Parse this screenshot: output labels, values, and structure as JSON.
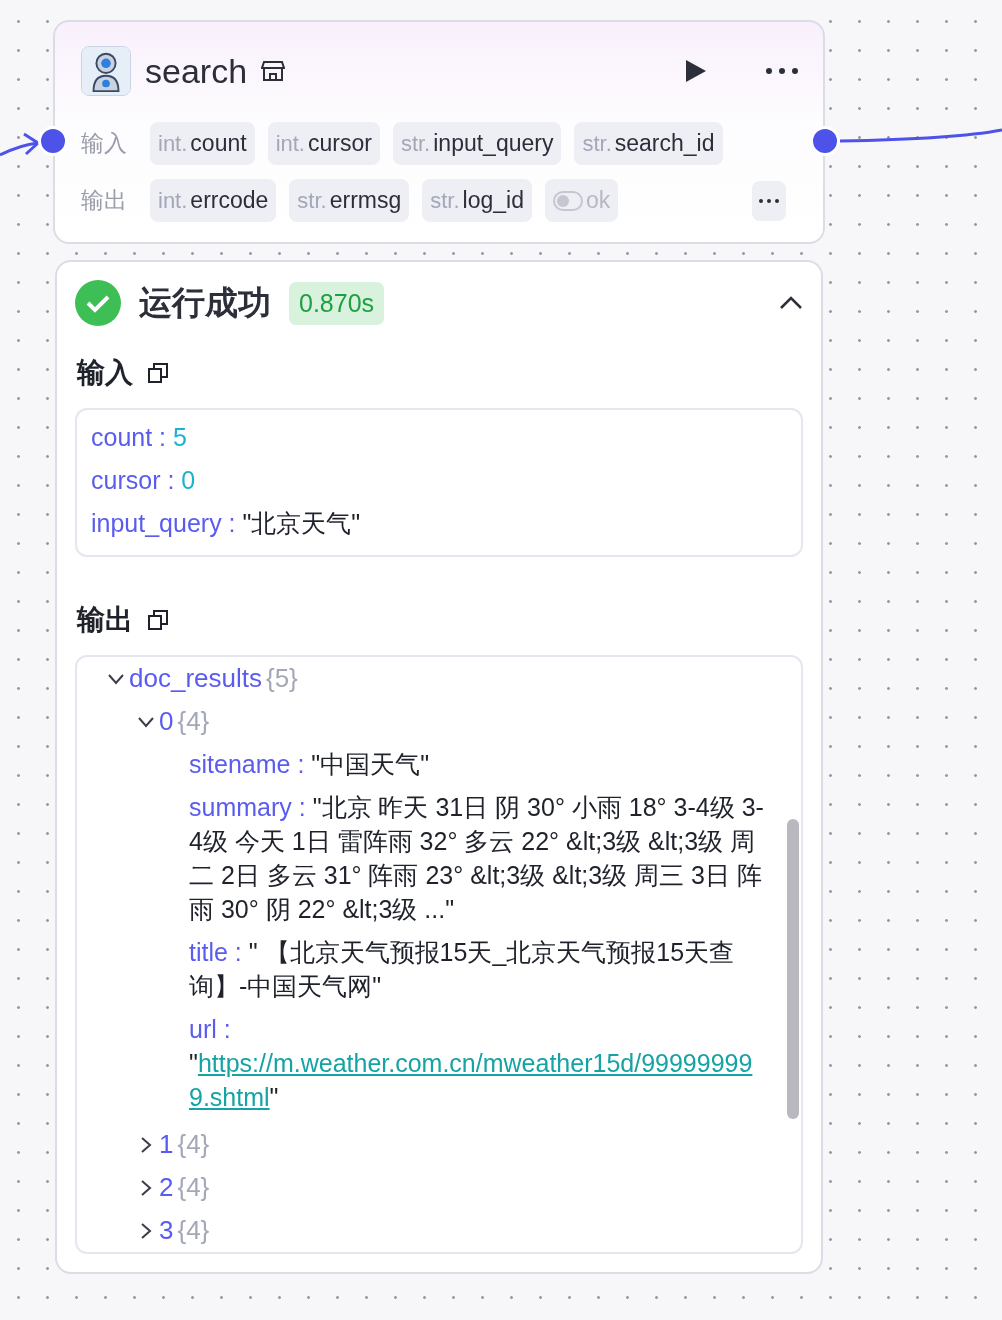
{
  "node": {
    "title": "search",
    "inputs": {
      "label": "输入",
      "ports": [
        {
          "kind": "typed",
          "type": "int.",
          "name": "count"
        },
        {
          "kind": "typed",
          "type": "int.",
          "name": "cursor"
        },
        {
          "kind": "typed",
          "type": "str.",
          "name": "input_query"
        },
        {
          "kind": "typed",
          "type": "str.",
          "name": "search_id"
        }
      ]
    },
    "outputs": {
      "label": "输出",
      "ports": [
        {
          "kind": "typed",
          "type": "int.",
          "name": "errcode"
        },
        {
          "kind": "typed",
          "type": "str.",
          "name": "errmsg"
        },
        {
          "kind": "typed",
          "type": "str.",
          "name": "log_id"
        },
        {
          "kind": "bool",
          "name": "ok",
          "disabled": true
        }
      ]
    }
  },
  "result": {
    "status": "运行成功",
    "duration": "0.870s",
    "expanded": true,
    "input": {
      "title": "输入",
      "fields": [
        {
          "key": "count",
          "sep": " : ",
          "kind": "number",
          "value": "5"
        },
        {
          "key": "cursor",
          "sep": " : ",
          "kind": "number",
          "value": "0"
        },
        {
          "key": "input_query",
          "sep": " : ",
          "kind": "string",
          "value": "\"北京天气\""
        }
      ]
    },
    "output": {
      "title": "输出",
      "tree": [
        {
          "key": "doc_results",
          "count": "{5}",
          "expanded": true,
          "children": [
            {
              "key": "0",
              "count": "{4}",
              "expanded": true,
              "fields": [
                {
                  "key": "sitename",
                  "sep": " : ",
                  "kind": "string",
                  "value": "\"中国天气\""
                },
                {
                  "key": "summary",
                  "sep": " : ",
                  "kind": "string",
                  "value": "\"北京 昨天 31日 阴 30° 小雨 18° 3-4级 3-4级 今天 1日 雷阵雨 32° 多云 22° &lt;3级 &lt;3级 周二 2日 多云 31° 阵雨 23° &lt;3级 &lt;3级 周三 3日 阵雨 30° 阴 22° &lt;3级 ...\""
                },
                {
                  "key": "title",
                  "sep": " : ",
                  "kind": "string",
                  "value": "\" 【北京天气预报15天_北京天气预报15天查询】-中国天气网\""
                },
                {
                  "key": "url",
                  "sep": " : ",
                  "kind": "link",
                  "prefix": "\"",
                  "value": "https://m.weather.com.cn/mweather15d/999999999.shtml",
                  "suffix": "\""
                }
              ]
            },
            {
              "key": "1",
              "count": "{4}",
              "expanded": false
            },
            {
              "key": "2",
              "count": "{4}",
              "expanded": false
            },
            {
              "key": "3",
              "count": "{4}",
              "expanded": false
            }
          ]
        }
      ]
    }
  }
}
